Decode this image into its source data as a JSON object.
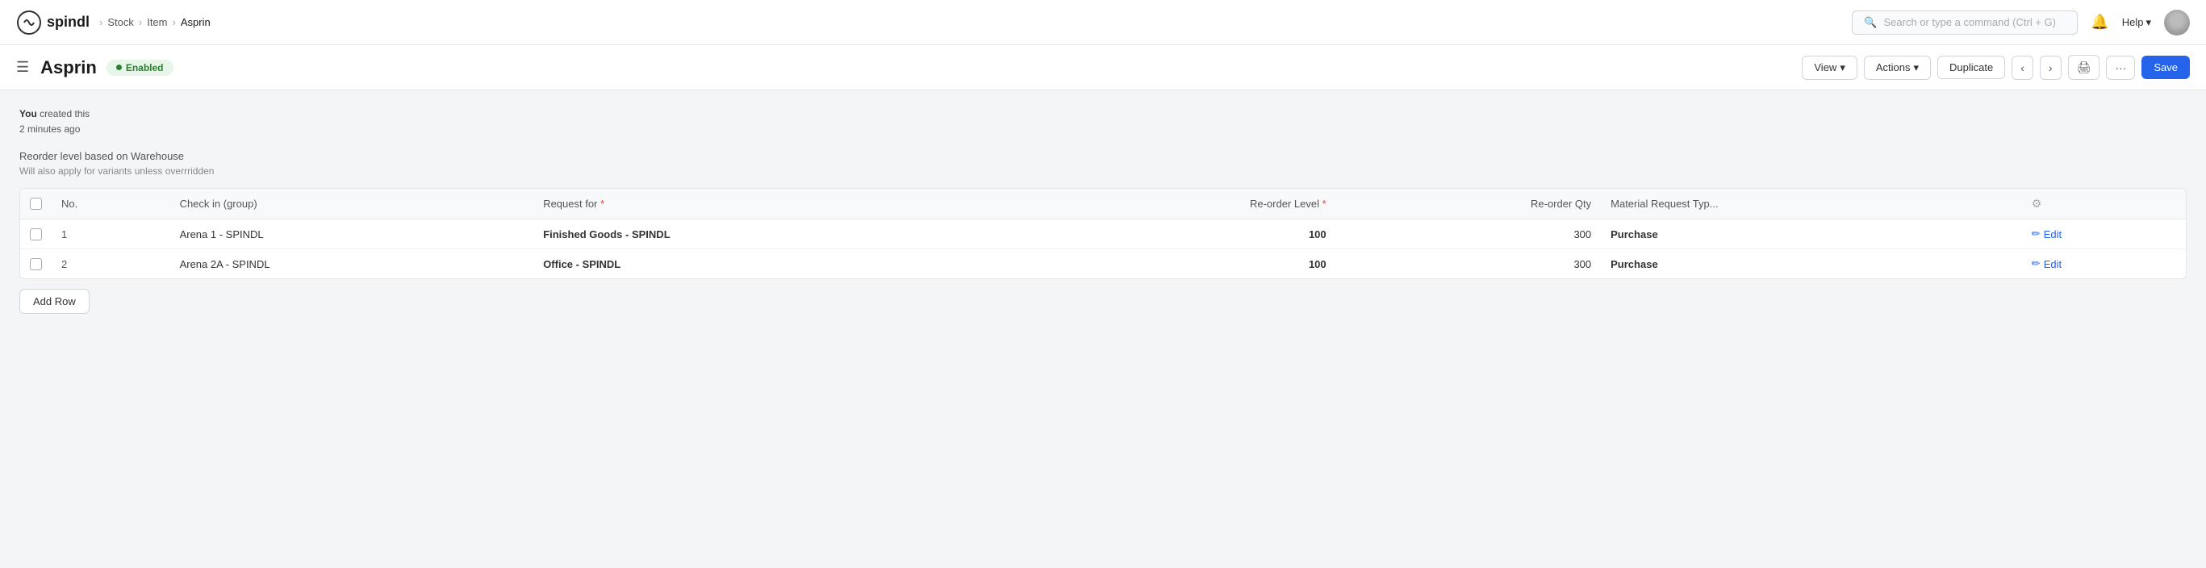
{
  "topnav": {
    "brand": "spindl",
    "breadcrumb": [
      {
        "label": "Stock",
        "type": "crumb"
      },
      {
        "label": "Item",
        "type": "crumb"
      },
      {
        "label": "Asprin",
        "type": "current"
      }
    ],
    "search_placeholder": "Search or type a command (Ctrl + G)",
    "help_label": "Help"
  },
  "subheader": {
    "title": "Asprin",
    "badge_label": "Enabled",
    "buttons": {
      "view": "View",
      "actions": "Actions",
      "duplicate": "Duplicate",
      "save": "Save"
    }
  },
  "activity": {
    "actor": "You",
    "action": "created this",
    "time": "2 minutes ago"
  },
  "section": {
    "description": "Reorder level based on Warehouse",
    "sub_description": "Will also apply for variants unless overrridden"
  },
  "table": {
    "columns": [
      {
        "key": "no",
        "label": "No.",
        "align": "left"
      },
      {
        "key": "checkin",
        "label": "Check in (group)",
        "align": "left"
      },
      {
        "key": "request_for",
        "label": "Request for",
        "align": "left",
        "required": true
      },
      {
        "key": "reorder_level",
        "label": "Re-order Level",
        "align": "right",
        "required": true
      },
      {
        "key": "reorder_qty",
        "label": "Re-order Qty",
        "align": "right"
      },
      {
        "key": "material_request_type",
        "label": "Material Request Typ...",
        "align": "left"
      },
      {
        "key": "actions",
        "label": "⚙",
        "align": "center"
      }
    ],
    "rows": [
      {
        "no": 1,
        "checkin": "Arena 1 - SPINDL",
        "request_for": "Finished Goods - SPINDL",
        "reorder_level": "100",
        "reorder_qty": 300,
        "material_request_type": "Purchase",
        "edit_label": "Edit"
      },
      {
        "no": 2,
        "checkin": "Arena 2A - SPINDL",
        "request_for": "Office - SPINDL",
        "reorder_level": "100",
        "reorder_qty": 300,
        "material_request_type": "Purchase",
        "edit_label": "Edit"
      }
    ],
    "add_row_label": "Add Row"
  }
}
